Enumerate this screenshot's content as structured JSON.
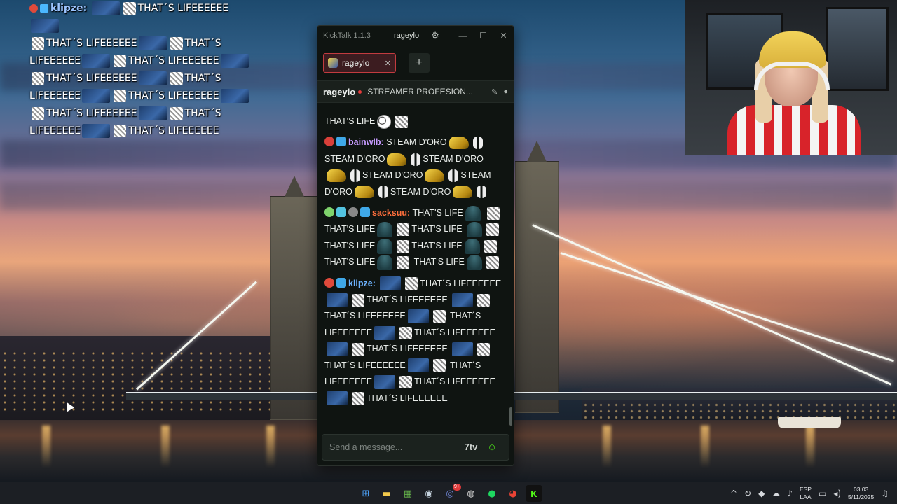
{
  "overlay_chat": {
    "username": "klipze:",
    "lines": [
      {
        "parts": [
          "THAT´S LIFEEEEEE"
        ]
      },
      {
        "parts": [
          "THAT´S LIFEEEEEE",
          "THAT´S"
        ]
      },
      {
        "parts": [
          "LIFEEEEEE",
          "THAT´S LIFEEEEEE"
        ]
      },
      {
        "parts": [
          "THAT´S LIFEEEEEE",
          "THAT´S"
        ]
      },
      {
        "parts": [
          "LIFEEEEEE",
          "THAT´S LIFEEEEEE"
        ]
      },
      {
        "parts": [
          "THAT´S LIFEEEEEE",
          "THAT´S"
        ]
      },
      {
        "parts": [
          "LIFEEEEEE",
          "THAT´S LIFEEEEEE"
        ]
      }
    ]
  },
  "kicktalk": {
    "app_title": "KickTalk 1.1.3",
    "user_pill": "rageylo",
    "settings_icon": "gear-icon",
    "window_controls": {
      "minimize": "—",
      "maximize": "☐",
      "close": "✕"
    },
    "tab": {
      "label": "rageylo",
      "close": "✕"
    },
    "add_tab": "+",
    "streamer": {
      "name": "rageylo",
      "title": "STREAMER PROFESION...",
      "icons": [
        "pin-icon",
        "user-icon"
      ]
    },
    "messages": {
      "m0": {
        "text1": "THAT'S LIFE"
      },
      "m1": {
        "user": "bainwlb:",
        "user_color": "#c79bff",
        "t1": "STEAM D'ORO",
        "t2": "STEAM D'ORO",
        "t3": "STEAM D'ORO",
        "t4": "STEAM D'ORO",
        "t5": "STEAM",
        "t6": "D'ORO",
        "t7": "STEAM D'ORO"
      },
      "m2": {
        "user": "sacksuu:",
        "user_color": "#ff6f3c",
        "t1": "THAT'S LIFE",
        "t2": "THAT'S LIFE",
        "t3": "THAT'S LIFE",
        "t4": "THAT'S LIFE",
        "t5": "THAT'S",
        "t6": "LIFE",
        "t7": "THAT'S LIFE",
        "t8": "THAT'S LIFE"
      },
      "m3": {
        "user": "klipze:",
        "user_color": "#6db3ff",
        "t1": "THAT´S",
        "t2": "LIFEEEEEE",
        "t3": "THAT´S LIFEEEEEE",
        "t4": "THAT´S LIFEEEEEE",
        "t5": "THAT´S LIFEEEEEE",
        "t6": "THAT´S",
        "t7": "LIFEEEEEE",
        "t8": "THAT´S LIFEEEEEE",
        "t9": "THAT´S LIFEEEEEE",
        "t10": "THAT´S LIFEEEEEE",
        "t11": "THAT´S",
        "t12": "LIFEEEEEE",
        "t13": "THAT´S LIFEEEEEE"
      }
    },
    "input": {
      "placeholder": "Send a message...",
      "emote_button": "7tv",
      "kick_button": "kick-emote-icon"
    }
  },
  "taskbar": {
    "apps": [
      {
        "name": "windows-start-icon",
        "glyph": "⊞",
        "color": "#4ea6ff"
      },
      {
        "name": "file-explorer-icon",
        "glyph": "▬",
        "color": "#f2c94c"
      },
      {
        "name": "minecraft-icon",
        "glyph": "▦",
        "color": "#6bbf4e"
      },
      {
        "name": "steam-icon",
        "glyph": "◉",
        "color": "#c7d5e0"
      },
      {
        "name": "discord-icon",
        "glyph": "◎",
        "color": "#7289da"
      },
      {
        "name": "obs-icon",
        "glyph": "◍",
        "color": "#d8d8d8"
      },
      {
        "name": "spotify-icon",
        "glyph": "●",
        "color": "#1ed760"
      },
      {
        "name": "chrome-icon",
        "glyph": "◕",
        "color": "#ea4335"
      },
      {
        "name": "kick-icon",
        "glyph": "K",
        "color": "#53fc18"
      }
    ],
    "discord_badge": "9+",
    "tray": {
      "language_top": "ESP",
      "language_bottom": "LAA",
      "time": "03:03",
      "date": "5/11/2025"
    }
  }
}
